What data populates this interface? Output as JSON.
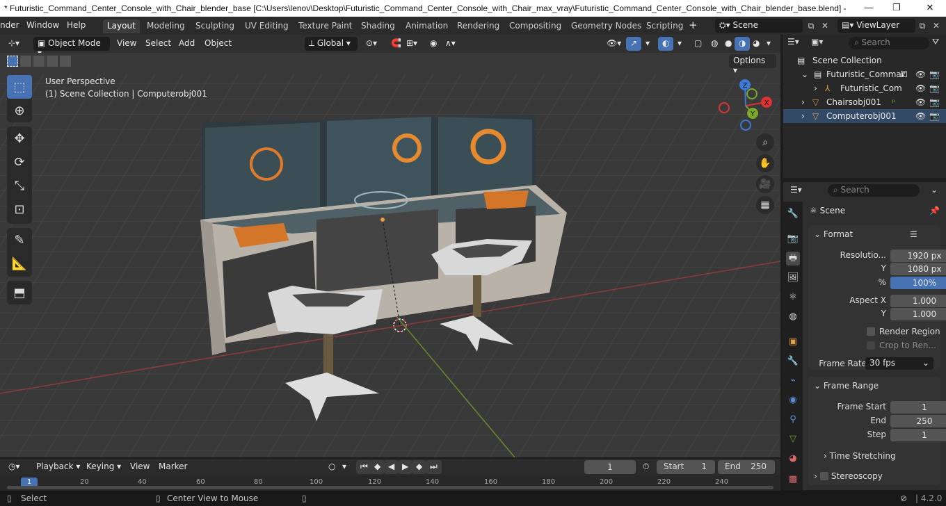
{
  "title": "* Futuristic_Command_Center_Console_with_Chair_blender_base [C:\\Users\\lenov\\Desktop\\Futuristic_Command_Center_Console_with_Chair_max_vray\\Futuristic_Command_Center_Console_with_Chair_blender_base.blend] - ...",
  "menus": [
    "nder",
    "Window",
    "Help"
  ],
  "workspaces": [
    "Layout",
    "Modeling",
    "Sculpting",
    "UV Editing",
    "Texture Paint",
    "Shading",
    "Animation",
    "Rendering",
    "Compositing",
    "Geometry Nodes",
    "Scripting"
  ],
  "scene": "Scene",
  "view_layer": "ViewLayer",
  "viewport_header": {
    "mode": "Object Mode",
    "view": "View",
    "select": "Select",
    "add": "Add",
    "object": "Object",
    "transform": "Global",
    "options": "Options"
  },
  "viewport": {
    "perspective": "User Perspective",
    "collection": "(1) Scene Collection | Computerobj001",
    "gizmo_x": "X",
    "gizmo_y": "Y",
    "gizmo_z": "Z"
  },
  "outliner": {
    "search_placeholder": "Search",
    "rows": [
      "Scene Collection",
      "Futuristic_Commar",
      "Futuristic_Com",
      "Chairsobj001",
      "Computerobj001"
    ]
  },
  "properties": {
    "search_placeholder": "Search",
    "context": "Scene",
    "format_label": "Format",
    "resolution_label": "Resolutio...",
    "res_x": "1920 px",
    "y_label": "Y",
    "res_y": "1080 px",
    "pct_label": "%",
    "pct": "100%",
    "aspect_x_label": "Aspect X",
    "aspect_x": "1.000",
    "aspect_y": "1.000",
    "render_region": "Render Region",
    "crop": "Crop to Ren...",
    "frame_rate_label": "Frame Rate",
    "frame_rate": "30 fps",
    "frame_range_label": "Frame Range",
    "frame_start_label": "Frame Start",
    "frame_start": "1",
    "end_label": "End",
    "end": "250",
    "step_label": "Step",
    "step": "1",
    "time_stretching": "Time Stretching",
    "stereoscopy": "Stereoscopy"
  },
  "timeline": {
    "playback": "Playback",
    "keying": "Keying",
    "view": "View",
    "marker": "Marker",
    "current_frame": "1",
    "start_label": "Start",
    "start": "1",
    "end_label": "End",
    "end": "250",
    "ticks": [
      "1",
      "20",
      "40",
      "60",
      "80",
      "100",
      "120",
      "140",
      "160",
      "180",
      "200",
      "220",
      "240"
    ]
  },
  "status": {
    "select": "Select",
    "center": "Center View to Mouse",
    "version": "4.2.0"
  }
}
